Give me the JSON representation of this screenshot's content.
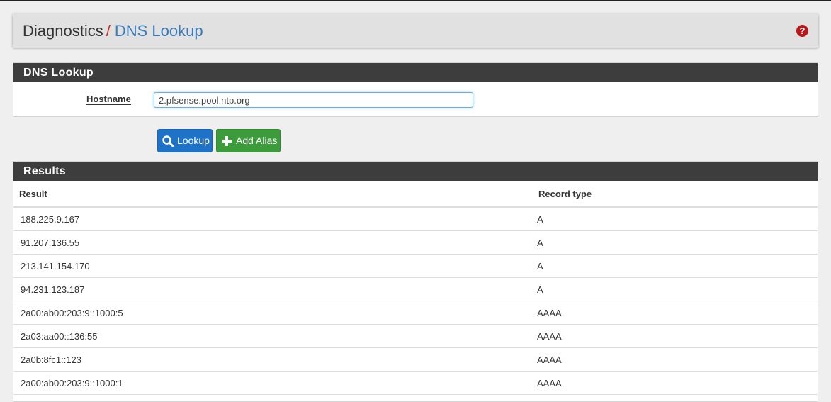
{
  "breadcrumb": {
    "parent": "Diagnostics",
    "separator": "/",
    "current": "DNS Lookup"
  },
  "help_icon": "question-circle-icon",
  "lookup_panel": {
    "heading": "DNS Lookup",
    "hostname_label": "Hostname",
    "hostname_value": "2.pfsense.pool.ntp.org"
  },
  "buttons": {
    "lookup": "Lookup",
    "add_alias": "Add Alias"
  },
  "results_panel": {
    "heading": "Results",
    "columns": [
      "Result",
      "Record type"
    ],
    "rows": [
      {
        "result": "188.225.9.167",
        "type": "A"
      },
      {
        "result": "91.207.136.55",
        "type": "A"
      },
      {
        "result": "213.141.154.170",
        "type": "A"
      },
      {
        "result": "94.231.123.187",
        "type": "A"
      },
      {
        "result": "2a00:ab00:203:9::1000:5",
        "type": "AAAA"
      },
      {
        "result": "2a03:aa00::136:55",
        "type": "AAAA"
      },
      {
        "result": "2a0b:8fc1::123",
        "type": "AAAA"
      },
      {
        "result": "2a00:ab00:203:9::1000:1",
        "type": "AAAA"
      }
    ]
  },
  "colors": {
    "heading_bg": "#3d3d3d",
    "link_blue": "#3a7ab8",
    "lookup_button": "#1e73c9",
    "alias_button": "#3c9c3c",
    "help_red": "#b5191a"
  }
}
